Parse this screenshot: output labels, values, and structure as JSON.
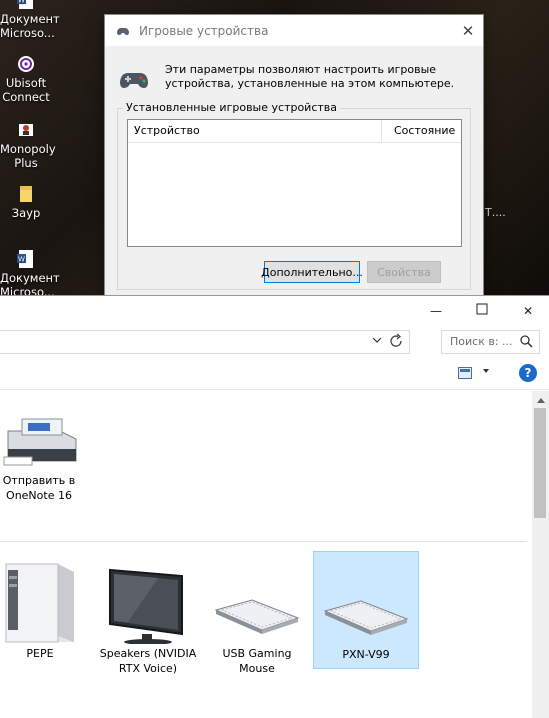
{
  "desktop": {
    "icons": [
      {
        "label_1": "Документ",
        "label_2": "Microso...",
        "name": "word-document-icon"
      },
      {
        "label_1": "Ubisoft",
        "label_2": "Connect",
        "name": "ubisoft-connect-icon"
      },
      {
        "label_1": "Monopoly",
        "label_2": "Plus",
        "name": "monopoly-plus-icon"
      },
      {
        "label_1": "Зауp",
        "label_2": "",
        "name": "folder-icon"
      },
      {
        "label_1": "Документ",
        "label_2": "Microso...",
        "name": "word-document-icon"
      }
    ],
    "side_text": "Т...."
  },
  "dialog": {
    "title": "Игровые устройства",
    "close": "✕",
    "description": "Эти параметры позволяют настроить игровые устройства, установленные на этом компьютере.",
    "group_label": "Установленные игровые устройства",
    "columns": [
      "Устройство",
      "Состояние"
    ],
    "advanced_button": "Дополнительно...",
    "properties_button": "Свойства"
  },
  "explorer": {
    "caption": {
      "minimize": "—",
      "maximize": "☐",
      "close": "✕"
    },
    "search_placeholder": "Поиск в: ...",
    "devices_top": [
      {
        "line1": "Отправить в",
        "line2": "OneNote 16"
      }
    ],
    "devices": [
      {
        "line1": "PEPE",
        "line2": ""
      },
      {
        "line1": "Speakers (NVIDIA",
        "line2": "RTX Voice)"
      },
      {
        "line1": "USB Gaming",
        "line2": "Mouse"
      },
      {
        "line1": "PXN-V99",
        "line2": ""
      }
    ],
    "help": "?"
  },
  "colors": {
    "selection": "#cce8ff",
    "help_blue": "#1b6ac9",
    "button_focus": "#0078d7"
  }
}
